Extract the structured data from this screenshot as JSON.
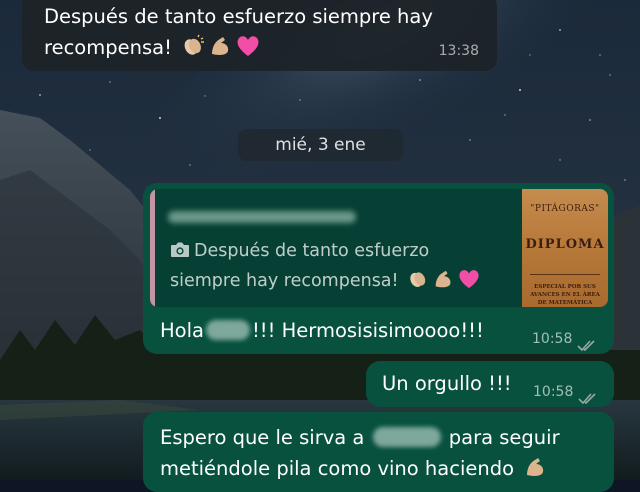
{
  "chat": {
    "msg1": {
      "text": "Después de tanto esfuerzo siempre hay recompensa! 👏🏼💪🏼💗",
      "line1": "Después de tanto esfuerzo siempre hay",
      "line2": "recompensa!",
      "time": "13:38"
    },
    "date_divider": "mié, 3 ene",
    "msg2": {
      "quote_line1": "Después de tanto esfuerzo",
      "quote_line2": "siempre hay recompensa!",
      "quote_image": {
        "header": "\"PITÁGORAS\"",
        "title": "DIPLOMA",
        "body": "ESPECIAL POR SUS AVANCES EN EL ÁREA DE MATEMÁTICA"
      },
      "text_before": "Hola",
      "text_after": "!!! Hermosisisimoooo!!!",
      "time": "10:58"
    },
    "msg3": {
      "text": "Un orgullo !!!",
      "time": "10:58"
    },
    "msg4": {
      "line1_before": "Espero que le sirva a",
      "line1_after": "para seguir",
      "line2": "metiéndole pila como vino haciendo"
    }
  },
  "colors": {
    "incoming_bubble": "#1c2228",
    "outgoing_bubble": "#08513f",
    "quote_background": "#064034",
    "quote_bar": "#c594a4",
    "read_ticks": "#9aa7a3"
  },
  "icons": [
    "camera-icon",
    "clapping-hands-icon",
    "flexed-biceps-icon",
    "pink-heart-icon",
    "double-check-icon"
  ]
}
